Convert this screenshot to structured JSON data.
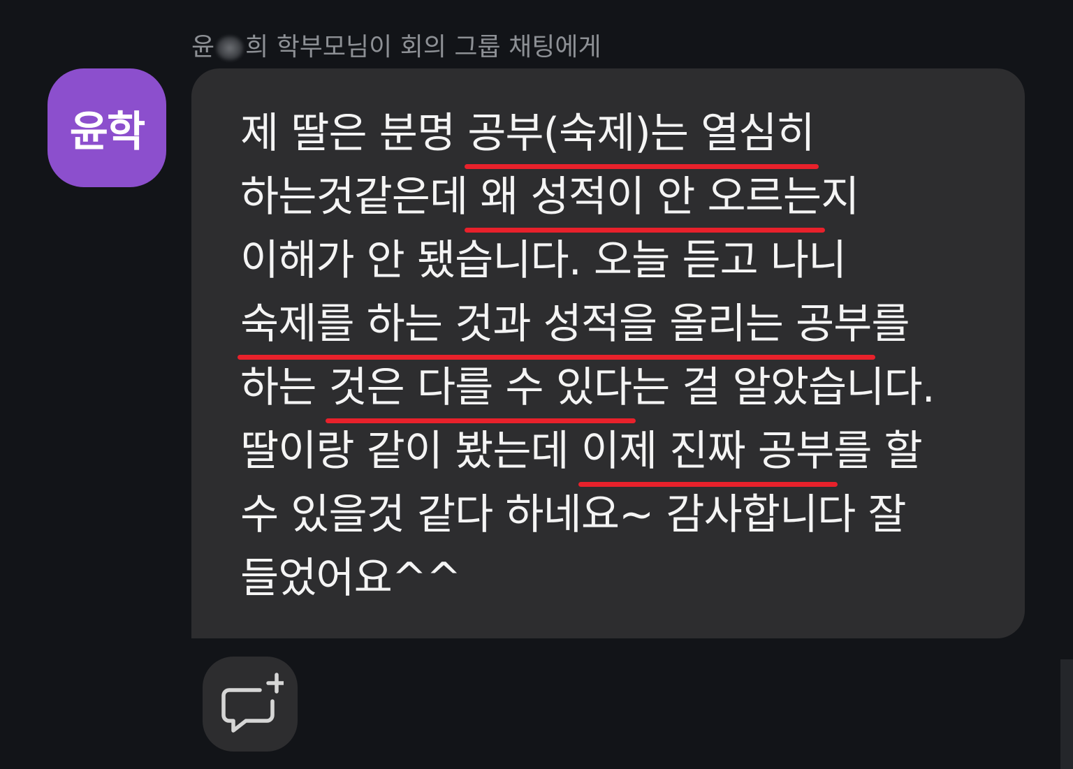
{
  "header": {
    "sender_prefix": "윤",
    "sender_suffix": "희 학부모님이 회의 그룹 채팅에게"
  },
  "avatar": {
    "label": "윤학",
    "color": "#8c4fcd"
  },
  "message": {
    "lines": [
      [
        {
          "t": "제 딸은 분명 "
        },
        {
          "t": "공부(숙제)는 열심히",
          "u": true
        }
      ],
      [
        {
          "t": "하는것같은데"
        },
        {
          "t": " 왜 성적이 안 오르는",
          "u": true
        },
        {
          "t": "지"
        }
      ],
      [
        {
          "t": "이해가 안 됐습니다. 오늘 듣고 나니"
        }
      ],
      [
        {
          "t": "숙제를 하는 것과 성적을 올리는 공부",
          "u": true
        },
        {
          "t": "를"
        }
      ],
      [
        {
          "t": "하는 "
        },
        {
          "t": "것은 다를 수 있다",
          "u": true
        },
        {
          "t": "는 걸 알았습니다."
        }
      ],
      [
        {
          "t": "딸이랑 같이 봤는데 "
        },
        {
          "t": "이제 진짜 공부",
          "u": true
        },
        {
          "t": "를 할"
        }
      ],
      [
        {
          "t": "수 있을것 같다 하네요~ 감사합니다 잘"
        }
      ],
      [
        {
          "t": "들었어요^^"
        }
      ]
    ],
    "highlight_color": "#e8212b"
  },
  "actions": {
    "react_icon": "add-comment-icon"
  }
}
